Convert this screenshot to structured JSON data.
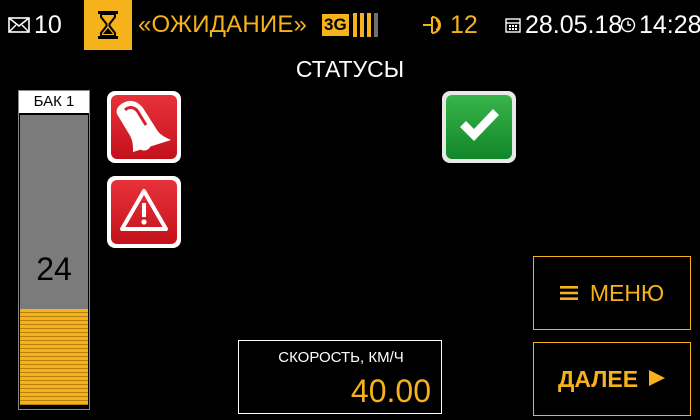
{
  "status_bar": {
    "messages_count": "10",
    "state_text": "«ОЖИДАНИЕ»",
    "network_label": "3G",
    "signal_strength": 3,
    "signal_max": 4,
    "gps_satellites": "12",
    "date": "28.05.18",
    "time": "14:28",
    "accent_color": "#f5b21a"
  },
  "page": {
    "title": "СТАТУСЫ"
  },
  "tank": {
    "label": "БАК 1",
    "value": "24",
    "fill_fraction": 0.33
  },
  "statuses": [
    {
      "icon": "bell-alarm-icon",
      "state": "alarm",
      "color": "#d91f28"
    },
    {
      "icon": "warning-triangle-icon",
      "state": "alarm",
      "color": "#d91f28"
    },
    {
      "icon": "checkmark-icon",
      "state": "ok",
      "color": "#22a03a"
    }
  ],
  "speed": {
    "label": "СКОРОСТЬ, КМ/Ч",
    "value": "40.00"
  },
  "buttons": {
    "menu_label": "МЕНЮ",
    "next_label": "ДАЛЕЕ"
  }
}
